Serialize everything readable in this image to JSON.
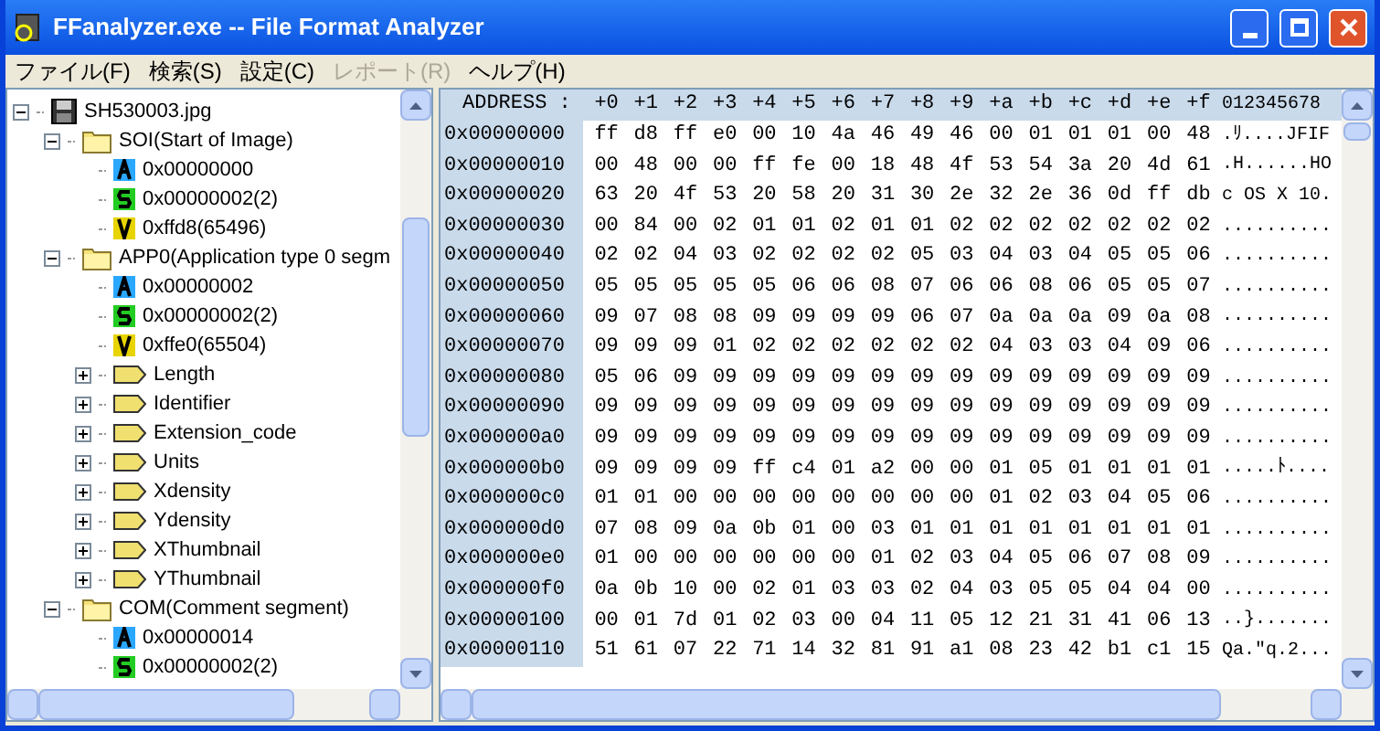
{
  "window": {
    "title": "FFanalyzer.exe -- File Format Analyzer"
  },
  "menu": [
    {
      "label": "ファイル(F)",
      "disabled": false
    },
    {
      "label": "検索(S)",
      "disabled": false
    },
    {
      "label": "設定(C)",
      "disabled": false
    },
    {
      "label": "レポート(R)",
      "disabled": true
    },
    {
      "label": "ヘルプ(H)",
      "disabled": false
    }
  ],
  "tree": [
    {
      "kind": "file",
      "label": "SH530003.jpg",
      "expanded": true,
      "children": [
        {
          "kind": "folder",
          "label": "SOI(Start of Image)",
          "expanded": true,
          "children": [
            {
              "kind": "address",
              "label": "0x00000000"
            },
            {
              "kind": "size",
              "label": "0x00000002(2)"
            },
            {
              "kind": "value",
              "label": "0xffd8(65496)"
            }
          ]
        },
        {
          "kind": "folder",
          "label": "APP0(Application type 0 segm",
          "expanded": true,
          "children": [
            {
              "kind": "address",
              "label": "0x00000002"
            },
            {
              "kind": "size",
              "label": "0x00000002(2)"
            },
            {
              "kind": "value",
              "label": "0xffe0(65504)"
            },
            {
              "kind": "field",
              "label": "Length",
              "expanded": false
            },
            {
              "kind": "field",
              "label": "Identifier",
              "expanded": false
            },
            {
              "kind": "field",
              "label": "Extension_code",
              "expanded": false
            },
            {
              "kind": "field",
              "label": "Units",
              "expanded": false
            },
            {
              "kind": "field",
              "label": "Xdensity",
              "expanded": false
            },
            {
              "kind": "field",
              "label": "Ydensity",
              "expanded": false
            },
            {
              "kind": "field",
              "label": "XThumbnail",
              "expanded": false
            },
            {
              "kind": "field",
              "label": "YThumbnail",
              "expanded": false
            }
          ]
        },
        {
          "kind": "folder",
          "label": "COM(Comment segment)",
          "expanded": true,
          "children": [
            {
              "kind": "address",
              "label": "0x00000014"
            },
            {
              "kind": "size",
              "label": "0x00000002(2)"
            }
          ]
        }
      ]
    }
  ],
  "hex": {
    "header": {
      "address": "ADDRESS :",
      "offsets": [
        "+0",
        "+1",
        "+2",
        "+3",
        "+4",
        "+5",
        "+6",
        "+7",
        "+8",
        "+9",
        "+a",
        "+b",
        "+c",
        "+d",
        "+e",
        "+f"
      ],
      "ascii": "012345678"
    },
    "rows": [
      {
        "address": "0x00000000",
        "bytes": [
          "ff",
          "d8",
          "ff",
          "e0",
          "00",
          "10",
          "4a",
          "46",
          "49",
          "46",
          "00",
          "01",
          "01",
          "01",
          "00",
          "48"
        ],
        "ascii": ".ﾘ....JFIF"
      },
      {
        "address": "0x00000010",
        "bytes": [
          "00",
          "48",
          "00",
          "00",
          "ff",
          "fe",
          "00",
          "18",
          "48",
          "4f",
          "53",
          "54",
          "3a",
          "20",
          "4d",
          "61"
        ],
        "ascii": ".H......HO"
      },
      {
        "address": "0x00000020",
        "bytes": [
          "63",
          "20",
          "4f",
          "53",
          "20",
          "58",
          "20",
          "31",
          "30",
          "2e",
          "32",
          "2e",
          "36",
          "0d",
          "ff",
          "db"
        ],
        "ascii": "c OS X 10."
      },
      {
        "address": "0x00000030",
        "bytes": [
          "00",
          "84",
          "00",
          "02",
          "01",
          "01",
          "02",
          "01",
          "01",
          "02",
          "02",
          "02",
          "02",
          "02",
          "02",
          "02"
        ],
        "ascii": ".........."
      },
      {
        "address": "0x00000040",
        "bytes": [
          "02",
          "02",
          "04",
          "03",
          "02",
          "02",
          "02",
          "02",
          "05",
          "03",
          "04",
          "03",
          "04",
          "05",
          "05",
          "06"
        ],
        "ascii": ".........."
      },
      {
        "address": "0x00000050",
        "bytes": [
          "05",
          "05",
          "05",
          "05",
          "05",
          "06",
          "06",
          "08",
          "07",
          "06",
          "06",
          "08",
          "06",
          "05",
          "05",
          "07"
        ],
        "ascii": ".........."
      },
      {
        "address": "0x00000060",
        "bytes": [
          "09",
          "07",
          "08",
          "08",
          "09",
          "09",
          "09",
          "09",
          "06",
          "07",
          "0a",
          "0a",
          "0a",
          "09",
          "0a",
          "08"
        ],
        "ascii": ".........."
      },
      {
        "address": "0x00000070",
        "bytes": [
          "09",
          "09",
          "09",
          "01",
          "02",
          "02",
          "02",
          "02",
          "02",
          "02",
          "04",
          "03",
          "03",
          "04",
          "09",
          "06"
        ],
        "ascii": ".........."
      },
      {
        "address": "0x00000080",
        "bytes": [
          "05",
          "06",
          "09",
          "09",
          "09",
          "09",
          "09",
          "09",
          "09",
          "09",
          "09",
          "09",
          "09",
          "09",
          "09",
          "09"
        ],
        "ascii": ".........."
      },
      {
        "address": "0x00000090",
        "bytes": [
          "09",
          "09",
          "09",
          "09",
          "09",
          "09",
          "09",
          "09",
          "09",
          "09",
          "09",
          "09",
          "09",
          "09",
          "09",
          "09"
        ],
        "ascii": ".........."
      },
      {
        "address": "0x000000a0",
        "bytes": [
          "09",
          "09",
          "09",
          "09",
          "09",
          "09",
          "09",
          "09",
          "09",
          "09",
          "09",
          "09",
          "09",
          "09",
          "09",
          "09"
        ],
        "ascii": ".........."
      },
      {
        "address": "0x000000b0",
        "bytes": [
          "09",
          "09",
          "09",
          "09",
          "ff",
          "c4",
          "01",
          "a2",
          "00",
          "00",
          "01",
          "05",
          "01",
          "01",
          "01",
          "01"
        ],
        "ascii": ".....ﾄ...."
      },
      {
        "address": "0x000000c0",
        "bytes": [
          "01",
          "01",
          "00",
          "00",
          "00",
          "00",
          "00",
          "00",
          "00",
          "00",
          "01",
          "02",
          "03",
          "04",
          "05",
          "06"
        ],
        "ascii": ".........."
      },
      {
        "address": "0x000000d0",
        "bytes": [
          "07",
          "08",
          "09",
          "0a",
          "0b",
          "01",
          "00",
          "03",
          "01",
          "01",
          "01",
          "01",
          "01",
          "01",
          "01",
          "01"
        ],
        "ascii": ".........."
      },
      {
        "address": "0x000000e0",
        "bytes": [
          "01",
          "00",
          "00",
          "00",
          "00",
          "00",
          "00",
          "01",
          "02",
          "03",
          "04",
          "05",
          "06",
          "07",
          "08",
          "09"
        ],
        "ascii": ".........."
      },
      {
        "address": "0x000000f0",
        "bytes": [
          "0a",
          "0b",
          "10",
          "00",
          "02",
          "01",
          "03",
          "03",
          "02",
          "04",
          "03",
          "05",
          "05",
          "04",
          "04",
          "00"
        ],
        "ascii": ".........."
      },
      {
        "address": "0x00000100",
        "bytes": [
          "00",
          "01",
          "7d",
          "01",
          "02",
          "03",
          "00",
          "04",
          "11",
          "05",
          "12",
          "21",
          "31",
          "41",
          "06",
          "13"
        ],
        "ascii": "..}......."
      },
      {
        "address": "0x00000110",
        "bytes": [
          "51",
          "61",
          "07",
          "22",
          "71",
          "14",
          "32",
          "81",
          "91",
          "a1",
          "08",
          "23",
          "42",
          "b1",
          "c1",
          "15"
        ],
        "ascii": "Qa.\"q.2..."
      }
    ]
  }
}
